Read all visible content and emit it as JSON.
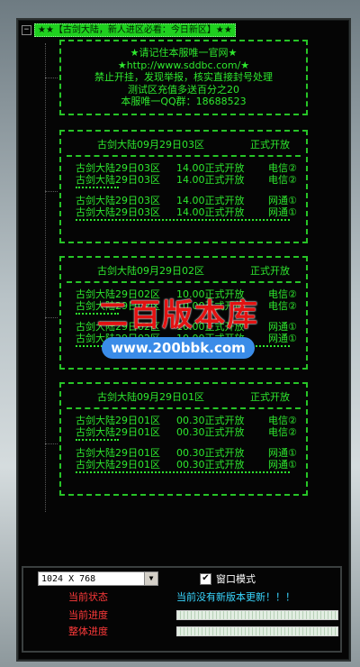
{
  "title": "★★【古剑大陆，新人进区必看：今日新区】★★",
  "notice": {
    "line1": "★请记住本服唯一官网★",
    "line2": "★http://www.sddbc.com/★",
    "line3": "禁止开挂，发现举报，核实直接封号处理",
    "line4": "测试区充值多送百分之20",
    "line5": "本服唯一QQ群：18688523"
  },
  "servers": [
    {
      "name": "古剑大陆09月29日03区",
      "status": "正式开放",
      "rows": [
        {
          "name": "古剑大陆29日03区",
          "time": "14.00正式开放",
          "line": "电信②"
        },
        {
          "name": "古剑大陆29日03区",
          "time": "14.00正式开放",
          "line": "电信②"
        },
        {
          "name": "古剑大陆29日03区",
          "time": "14.00正式开放",
          "line": "网通①"
        },
        {
          "name": "古剑大陆29日03区",
          "time": "14.00正式开放",
          "line": "网通①"
        }
      ]
    },
    {
      "name": "古剑大陆09月29日02区",
      "status": "正式开放",
      "rows": [
        {
          "name": "古剑大陆29日02区",
          "time": "10.00正式开放",
          "line": "电信②"
        },
        {
          "name": "古剑大陆29日02区",
          "time": "10.00正式开放",
          "line": "电信②"
        },
        {
          "name": "古剑大陆29日02区",
          "time": "10.00正式开放",
          "line": "网通①"
        },
        {
          "name": "古剑大陆29日02区",
          "time": "10.00正式开放",
          "line": "网通①"
        }
      ]
    },
    {
      "name": "古剑大陆09月29日01区",
      "status": "正式开放",
      "rows": [
        {
          "name": "古剑大陆29日01区",
          "time": "00.30正式开放",
          "line": "电信②"
        },
        {
          "name": "古剑大陆29日01区",
          "time": "00.30正式开放",
          "line": "电信②"
        },
        {
          "name": "古剑大陆29日01区",
          "time": "00.30正式开放",
          "line": "网通①"
        },
        {
          "name": "古剑大陆29日01区",
          "time": "00.30正式开放",
          "line": "网通①"
        }
      ]
    }
  ],
  "watermark": {
    "brand": "二百版本库",
    "url": "www.200bbk.com"
  },
  "bottom": {
    "resolution": "1024 X 768",
    "window_mode_label": "窗口模式",
    "window_mode_checked": "✔",
    "status_label": "当前状态",
    "status_text": "当前没有新版本更新！！！",
    "current_progress_label": "当前进度",
    "total_progress_label": "整体进度",
    "current_progress": 1.0,
    "total_progress": 1.0
  },
  "colors": {
    "accent": "#2ee82e",
    "label": "#ff3a3a",
    "status": "#39d6ff"
  }
}
